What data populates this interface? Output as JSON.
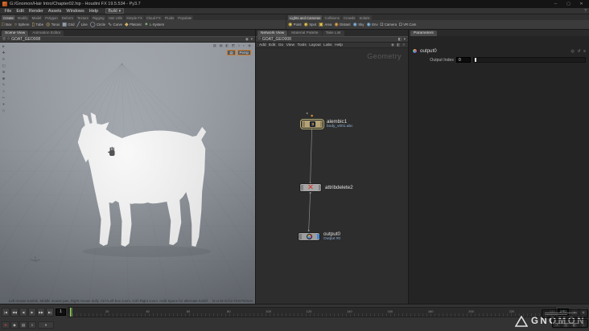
{
  "window": {
    "title": "G:/Gnomon/Hair Intro/Chapter02.hip - Houdini FX 19.5.534 - Py3.7",
    "minimize": "─",
    "maximize": "▢",
    "close": "✕"
  },
  "icons": {
    "caret_down": "▾",
    "house": "⌂",
    "pin": "◎",
    "help": "?",
    "x_mark": "✕"
  },
  "menubar": {
    "menus": [
      "File",
      "Edit",
      "Render",
      "Assets",
      "Windows",
      "Help"
    ],
    "desktop": "Build"
  },
  "shelf": {
    "left_tabs": [
      "Create",
      "Modify",
      "Model",
      "Polygon",
      "Deform",
      "Texture",
      "Rigging",
      "Hair Utils",
      "Simple FX",
      "Cloud FX",
      "Fluids",
      "Populate"
    ],
    "left_tools": [
      {
        "icon": "□",
        "label": "Box",
        "color": "#d8b36a"
      },
      {
        "icon": "○",
        "label": "Sphere",
        "color": "#d8b36a"
      },
      {
        "icon": "▯",
        "label": "Tube",
        "color": "#d8b36a"
      },
      {
        "icon": "◎",
        "label": "Torus",
        "color": "#d8b36a"
      },
      {
        "icon": "▦",
        "label": "Grid",
        "color": "#b9c7d6"
      },
      {
        "icon": "╱",
        "label": "Line",
        "color": "#b9c7d6"
      },
      {
        "icon": "◯",
        "label": "Circle",
        "color": "#b9c7d6"
      },
      {
        "icon": "∿",
        "label": "Curve",
        "color": "#b9c7d6"
      },
      {
        "icon": "◆",
        "label": "Platonic",
        "color": "#d8b36a"
      },
      {
        "icon": "✶",
        "label": "L-System",
        "color": "#9fd19a"
      }
    ],
    "right_tabs": [
      "Lights and Cameras",
      "Collisions",
      "Crowds",
      "Solaris"
    ],
    "right_tools": [
      {
        "icon": "◉",
        "label": "Point",
        "color": "#e8c84a"
      },
      {
        "icon": "◉",
        "label": "Spot",
        "color": "#e8c84a"
      },
      {
        "icon": "▣",
        "label": "Area",
        "color": "#e8c84a"
      },
      {
        "icon": "◉",
        "label": "Distant",
        "color": "#e8a24a"
      },
      {
        "icon": "◉",
        "label": "Sky",
        "color": "#7fb8e8"
      },
      {
        "icon": "◉",
        "label": "Env",
        "color": "#7fb8e8"
      },
      {
        "icon": "◘",
        "label": "Camera",
        "color": "#a8a8a8"
      },
      {
        "icon": "◘",
        "label": "VR Cam",
        "color": "#a8a8a8"
      }
    ]
  },
  "left_pane": {
    "tabs": [
      "Scene View",
      "Animation Editor"
    ],
    "path": {
      "context": "GOAT_GEO008"
    },
    "path_icons": [
      {
        "glyph": "◉",
        "name": "camera-icon"
      },
      {
        "glyph": "▾",
        "name": "viewport-menu-icon"
      }
    ],
    "toolbar_icons": [
      {
        "glyph": "►",
        "name": "select-tool-icon"
      },
      {
        "glyph": "✚",
        "name": "move-tool-icon"
      },
      {
        "glyph": "↻",
        "name": "rotate-tool-icon"
      },
      {
        "glyph": "◱",
        "name": "scale-tool-icon"
      },
      {
        "glyph": "⊞",
        "name": "handles-tool-icon"
      },
      {
        "glyph": "◉",
        "name": "view-tool-icon"
      },
      {
        "glyph": "✎",
        "name": "edit-tool-icon"
      },
      {
        "glyph": "≡",
        "name": "snap-options-icon"
      },
      {
        "glyph": "✂",
        "name": "cut-tool-icon"
      },
      {
        "glyph": "●",
        "name": "brush-tool-icon"
      },
      {
        "glyph": "◇",
        "name": "misc-tool-icon"
      }
    ],
    "display_icons": [
      {
        "glyph": "▦",
        "name": "grid-toggle-icon"
      },
      {
        "glyph": "▣",
        "name": "shading-mode-icon"
      },
      {
        "glyph": "◧",
        "name": "display-options-icon"
      },
      {
        "glyph": "◩",
        "name": "lighting-mode-icon"
      },
      {
        "glyph": "≡",
        "name": "view-menu-icon"
      },
      {
        "glyph": "◐",
        "name": "background-toggle-icon"
      },
      {
        "glyph": "◉",
        "name": "camera-view-icon"
      }
    ],
    "viewport": {
      "cam_icon": "▤",
      "cam_label": "Persp",
      "status_left": "Left mouse tumble, Middle mouse pan, Right mouse dolly.  Ctrl+Left box zoom, Ctrl+Right zoom.  Hold Space for alternate tumble, dolly, and zoom.",
      "status_right": "N or M+N for First Person"
    }
  },
  "network_pane": {
    "tabs": [
      "Network View",
      "Material Palette",
      "Take List"
    ],
    "path": {
      "context": "GOAT_GEO008"
    },
    "path_icons": [
      {
        "glyph": "◧",
        "name": "filter-icon"
      },
      {
        "glyph": "▾",
        "name": "network-menu-icon"
      }
    ],
    "menus": [
      "Add",
      "Edit",
      "Go",
      "View",
      "Tools",
      "Layout",
      "Labs",
      "Help"
    ],
    "menu_icons": [
      {
        "glyph": "◉",
        "name": "snapshot-icon"
      },
      {
        "glyph": "◧",
        "name": "color-palette-icon"
      },
      {
        "glyph": "≡",
        "name": "network-options-icon"
      }
    ],
    "context_label": "Geometry",
    "nodes": {
      "alembic": {
        "name": "alembic1",
        "subtitle": "body_v001.abc"
      },
      "attribdelete": {
        "name": "attribdelete2"
      },
      "output": {
        "name": "output0",
        "subtitle": "Output #0"
      }
    }
  },
  "param_pane": {
    "tabs": [
      "Parameters"
    ],
    "node_name": "output0",
    "header_icons": [
      {
        "glyph": "◎",
        "name": "pin-icon"
      },
      {
        "glyph": "↺",
        "name": "revert-icon"
      },
      {
        "glyph": "≡",
        "name": "gear-icon"
      }
    ],
    "param_label": "Output Index",
    "param_value": "0"
  },
  "playbar": {
    "transport": [
      {
        "glyph": "|◀",
        "name": "jump-start-button"
      },
      {
        "glyph": "◀◀",
        "name": "play-backward-button"
      },
      {
        "glyph": "◀",
        "name": "step-back-button"
      },
      {
        "glyph": "▶",
        "name": "step-forward-button"
      },
      {
        "glyph": "▶▶",
        "name": "play-forward-button"
      },
      {
        "glyph": "▶|",
        "name": "jump-end-button"
      }
    ],
    "current_frame": "1",
    "end_frame": "240",
    "tick_labels": [
      "20",
      "40",
      "60",
      "80",
      "100",
      "120",
      "140",
      "160",
      "180",
      "200",
      "220",
      "240"
    ],
    "row1_right": [
      {
        "glyph": "▾",
        "name": "playback-menu-button"
      },
      {
        "glyph": "◉",
        "name": "realtime-toggle"
      }
    ],
    "left_tools": [
      {
        "glyph": "●",
        "name": "auto-key-toggle",
        "color": "#d04038"
      },
      {
        "glyph": "◆",
        "name": "set-key-button"
      },
      {
        "glyph": "▤",
        "name": "motion-options-button"
      },
      {
        "glyph": "≡",
        "name": "playback-options-button"
      }
    ],
    "right_tools": [
      {
        "glyph": "↺",
        "name": "reset-range-button"
      },
      {
        "glyph": "▥",
        "name": "range-slider-button"
      },
      {
        "glyph": "◧",
        "name": "subrange-button"
      },
      {
        "glyph": "≡",
        "name": "global-anim-options-button"
      }
    ]
  },
  "watermark": {
    "text": "GNOMON"
  }
}
